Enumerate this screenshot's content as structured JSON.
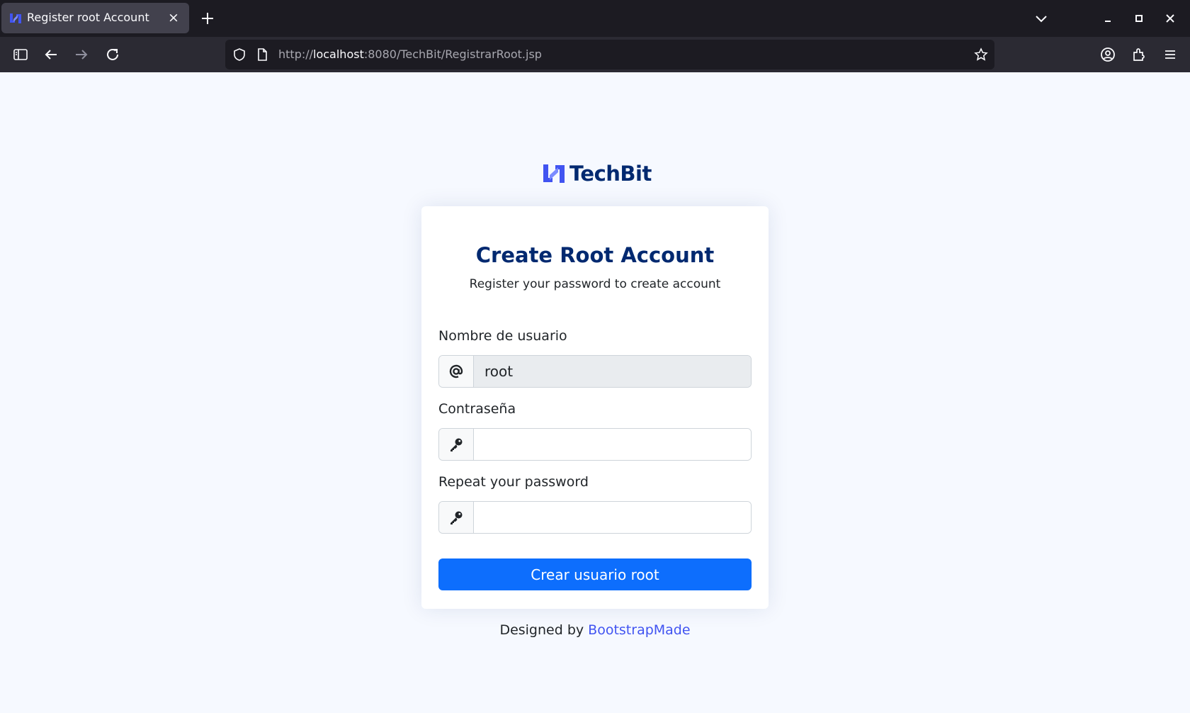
{
  "browser": {
    "tab_title": "Register root Account",
    "url_prefix": "http://",
    "url_host": "localhost",
    "url_path": ":8080/TechBit/RegistrarRoot.jsp"
  },
  "page": {
    "brand": "TechBit",
    "card_title": "Create Root Account",
    "card_subtitle": "Register your password to create account",
    "fields": {
      "username_label": "Nombre de usuario",
      "username_value": "root",
      "password_label": "Contraseña",
      "repeat_label": "Repeat your password"
    },
    "submit_label": "Crear usuario root",
    "credits_prefix": "Designed by ",
    "credits_link": "BootstrapMade"
  },
  "colors": {
    "brand_navy": "#012970",
    "brand_accent": "#4154f1",
    "primary_button": "#0d6efd",
    "page_background": "#f6f9ff"
  },
  "icons": [
    "techbit-logo-icon",
    "at-icon",
    "key-icon",
    "new-tab-icon",
    "close-icon",
    "sidebar-icon",
    "back-icon",
    "forward-icon",
    "reload-icon",
    "shield-icon",
    "page-icon",
    "bookmark-star-icon",
    "account-icon",
    "extensions-icon",
    "menu-icon"
  ]
}
